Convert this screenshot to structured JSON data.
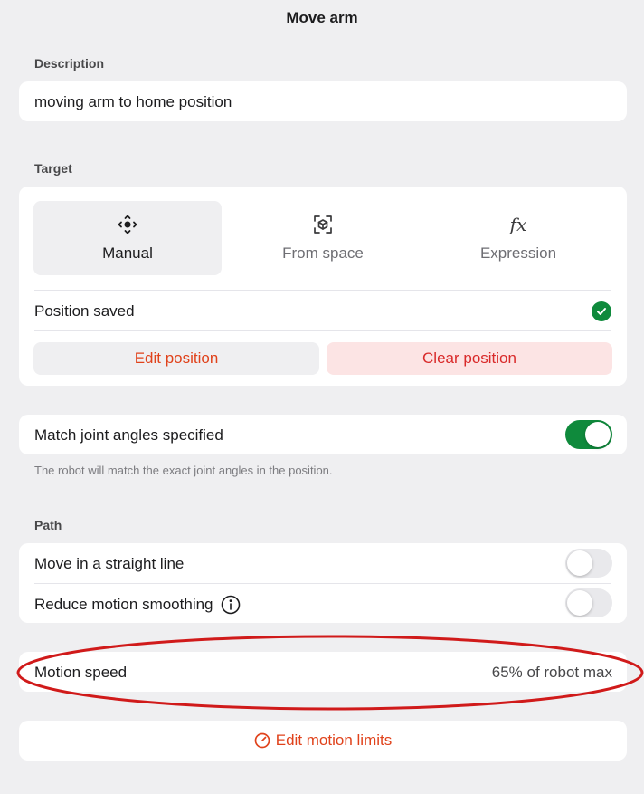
{
  "header": {
    "title": "Move arm"
  },
  "description": {
    "label": "Description",
    "value": "moving arm to home position"
  },
  "target": {
    "label": "Target",
    "modes": [
      {
        "label": "Manual",
        "icon": "move-arrows-icon",
        "selected": true
      },
      {
        "label": "From space",
        "icon": "cube-scan-icon",
        "selected": false
      },
      {
        "label": "Expression",
        "icon": "fx-icon",
        "glyph": "fx",
        "selected": false
      }
    ],
    "status_text": "Position saved",
    "status_icon": "check-circle-icon",
    "edit_label": "Edit position",
    "clear_label": "Clear position"
  },
  "match_joint": {
    "label": "Match joint angles specified",
    "enabled": true,
    "hint": "The robot will match the exact joint angles in the position."
  },
  "path": {
    "label": "Path",
    "options": [
      {
        "label": "Move in a straight line",
        "enabled": false
      },
      {
        "label": "Reduce motion smoothing",
        "enabled": false,
        "info_icon": "info-icon"
      }
    ]
  },
  "motion_speed": {
    "label": "Motion speed",
    "value": "65% of robot max"
  },
  "motion_limits": {
    "label": "Edit motion limits",
    "icon": "gauge-icon"
  },
  "colors": {
    "accent": "#e0421b",
    "danger": "#d92a2a",
    "success": "#0f8a3c",
    "background": "#efeff1",
    "annotation": "#d01a1a"
  }
}
